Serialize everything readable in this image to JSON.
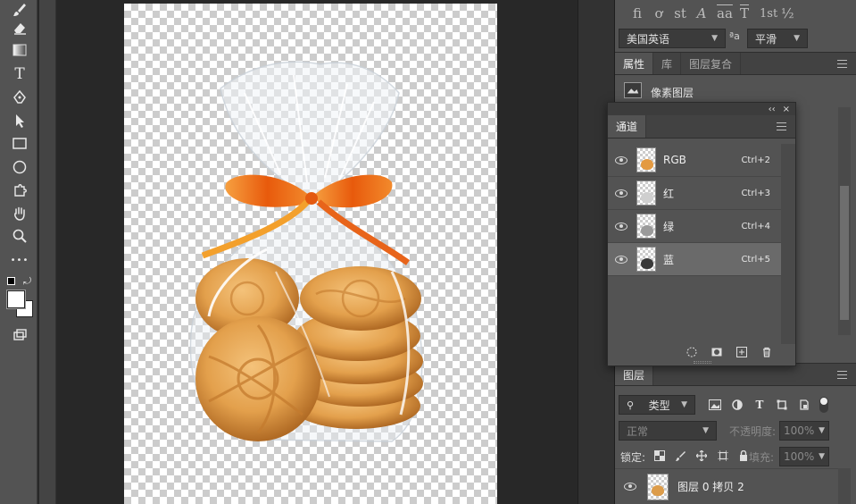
{
  "toolbar": {
    "tools": [
      {
        "name": "brush-tool",
        "icon": "brush-icon"
      },
      {
        "name": "eraser-tool",
        "icon": "eraser-icon"
      },
      {
        "name": "gradient-tool",
        "icon": "gradient-icon"
      },
      {
        "name": "type-tool",
        "icon": "type-icon",
        "glyph": "T"
      },
      {
        "name": "pen-tool",
        "icon": "pen-icon"
      },
      {
        "name": "path-selection-tool",
        "icon": "arrow-icon"
      },
      {
        "name": "rectangle-tool",
        "icon": "rectangle-icon"
      },
      {
        "name": "ellipse-tool",
        "icon": "ellipse-icon"
      },
      {
        "name": "custom-shape-tool",
        "icon": "puzzle-icon"
      },
      {
        "name": "hand-tool",
        "icon": "hand-icon"
      },
      {
        "name": "zoom-tool",
        "icon": "zoom-icon"
      },
      {
        "name": "more-tools",
        "icon": "ellipsis-icon",
        "glyph": "•••"
      }
    ],
    "foreground_color": "#000000",
    "background_color": "#ffffff"
  },
  "opentype": {
    "glyphs": [
      "fi",
      "ơ",
      "st",
      "A",
      "aa",
      "T",
      "1st",
      "½"
    ]
  },
  "character": {
    "language": "美国英语",
    "aa_label": "ªa",
    "antialias": "平滑"
  },
  "properties_panel": {
    "tabs": [
      "属性",
      "库",
      "图层复合"
    ],
    "active_tab": "属性",
    "item_label": "像素图层"
  },
  "channels_panel": {
    "tab": "通道",
    "collapse_glyph": "‹‹",
    "close_glyph": "×",
    "channels": [
      {
        "name": "RGB",
        "shortcut": "Ctrl+2",
        "selected": false
      },
      {
        "name": "红",
        "shortcut": "Ctrl+3",
        "selected": false
      },
      {
        "name": "绿",
        "shortcut": "Ctrl+4",
        "selected": false
      },
      {
        "name": "蓝",
        "shortcut": "Ctrl+5",
        "selected": true
      }
    ]
  },
  "layers_panel": {
    "tab": "图层",
    "filter_kind": "类型",
    "blend_mode": "正常",
    "opacity_label": "不透明度:",
    "opacity_value": "100%",
    "lock_label": "锁定:",
    "fill_label": "填充:",
    "fill_value": "100%",
    "layers": [
      {
        "name": "图层 0 拷贝 2",
        "visible": true
      }
    ]
  },
  "colors": {
    "panel_bg": "#535353",
    "canvas_bg": "#282828",
    "ribbon": "#f07a1a",
    "cookie": "#d99640"
  }
}
